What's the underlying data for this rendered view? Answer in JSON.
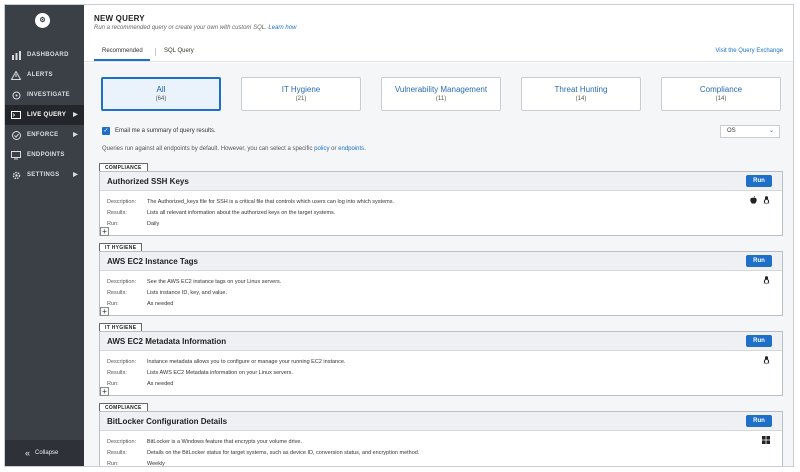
{
  "sidebar": {
    "logo": "⚙",
    "items": [
      {
        "label": "DASHBOARD"
      },
      {
        "label": "ALERTS"
      },
      {
        "label": "INVESTIGATE"
      },
      {
        "label": "LIVE QUERY"
      },
      {
        "label": "ENFORCE"
      },
      {
        "label": "ENDPOINTS"
      },
      {
        "label": "SETTINGS"
      }
    ],
    "collapse_label": "Collapse"
  },
  "page": {
    "title": "NEW QUERY",
    "subtitle": "Run a recommended query or create your own with custom SQL.",
    "learn_link": "Learn how"
  },
  "tabs": {
    "recommended": "Recommended",
    "sql": "SQL Query",
    "exchange_link": "Visit the Query Exchange"
  },
  "categories": [
    {
      "name": "All",
      "count": "(64)"
    },
    {
      "name": "IT Hygiene",
      "count": "(21)"
    },
    {
      "name": "Vulnerability Management",
      "count": "(11)"
    },
    {
      "name": "Threat Hunting",
      "count": "(14)"
    },
    {
      "name": "Compliance",
      "count": "(14)"
    }
  ],
  "email_label": "Email me a summary of query results.",
  "os_select": "OS",
  "note": {
    "text": "Queries run against all endpoints by default. However, you can select a specific",
    "policy_link": "policy",
    "or": "or",
    "endpoints_link": "endpoints",
    "end": "."
  },
  "labels": {
    "description": "Description:",
    "results": "Results:",
    "run": "Run:",
    "run_button": "Run"
  },
  "queries": [
    {
      "tag": "COMPLIANCE",
      "title": "Authorized SSH Keys",
      "description": "The Authorized_keys file for SSH is a critical file that controls which users can log into which systems.",
      "results": "Lists all relevant information about the authorized keys on the target systems.",
      "run": "Daily"
    },
    {
      "tag": "IT HYGIENE",
      "title": "AWS EC2 Instance Tags",
      "description": "See the AWS EC2 instance tags on your Linux servers.",
      "results": "Lists instance ID, key, and value.",
      "run": "As needed"
    },
    {
      "tag": "IT HYGIENE",
      "title": "AWS EC2 Metadata Information",
      "description": "Instance metadata allows you to configure or manage your running EC2 instance.",
      "results": "Lists AWS EC2 Metadata information on your Linux servers.",
      "run": "As needed"
    },
    {
      "tag": "COMPLIANCE",
      "title": "BitLocker Configuration Details",
      "description": "BitLocker is a Windows feature that encrypts your volume drive.",
      "results": "Details on the BitLocker status for target systems, such as device ID, conversion status, and encryption method.",
      "run": "Weekly"
    }
  ],
  "icons": {
    "accent": "#1d6fc7",
    "os_icons": [
      "apple-icon",
      "linux-icon",
      "windows-icon"
    ]
  }
}
